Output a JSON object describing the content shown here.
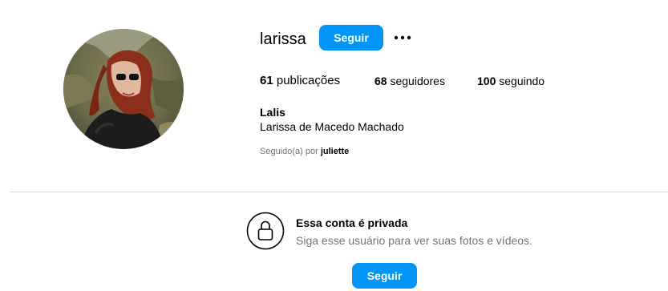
{
  "profile": {
    "username": "larissa",
    "follow_label": "Seguir",
    "more_icon": "more-horizontal-icon",
    "display_name": "Lalis",
    "full_name": "Larissa de Macedo Machado",
    "followed_by_prefix": "Seguido(a) por",
    "followed_by_user": "juliette"
  },
  "stats": {
    "posts_count": "61",
    "posts_label": "publicações",
    "followers_count": "68",
    "followers_label": "seguidores",
    "following_count": "100",
    "following_label": "seguindo"
  },
  "private_notice": {
    "icon": "lock-icon",
    "title": "Essa conta é privada",
    "description": "Siga esse usuário para ver suas fotos e vídeos.",
    "follow_label": "Seguir"
  },
  "colors": {
    "accent": "#0095f6",
    "secondary_text": "#737373",
    "divider": "#dbdbdb"
  }
}
